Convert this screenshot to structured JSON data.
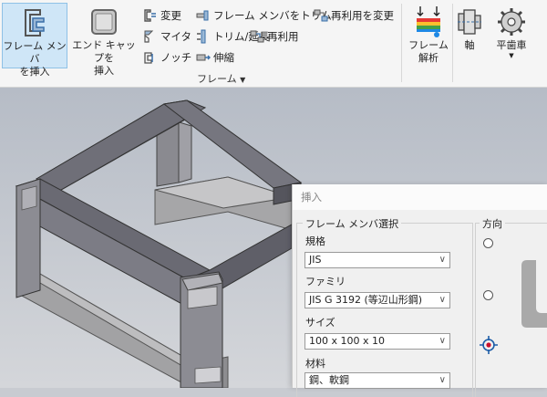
{
  "ribbon": {
    "insert_frame_member": "フレーム メンバ\nを挿入",
    "insert_frame_member_l1": "フレーム メンバ",
    "insert_frame_member_l2": "を挿入",
    "end_cap_l1": "エンド キャップを",
    "end_cap_l2": "挿入",
    "col1": [
      "変更",
      "マイタ",
      "ノッチ"
    ],
    "col2": [
      "フレーム メンバをトリム",
      "トリム/延長",
      "伸縮"
    ],
    "col3": [
      "再利用を変更",
      "再利用"
    ],
    "group_label": "フレーム",
    "frame_analysis_l1": "フレーム",
    "frame_analysis_l2": "解析",
    "shaft": "軸",
    "spur_gear": "平歯車"
  },
  "dialog": {
    "title": "挿入",
    "frame_section_title": "フレーム メンバ選択",
    "standard_label": "規格",
    "standard_value": "JIS",
    "family_label": "ファミリ",
    "family_value": "JIS G 3192 (等辺山形鋼)",
    "size_label": "サイズ",
    "size_value": "100 x 100 x 10",
    "material_label": "材料",
    "material_value": "鋼、軟鋼",
    "orientation_title": "方向"
  },
  "colors": {
    "ribbon_bg": "#f5f5f5",
    "selected_button": "#cfe6f7",
    "viewport_bg": "#c8cbd1",
    "frame_member": "#6e6e78",
    "accent_blue": "#1e5ea8",
    "accent_red": "#c8102e"
  }
}
